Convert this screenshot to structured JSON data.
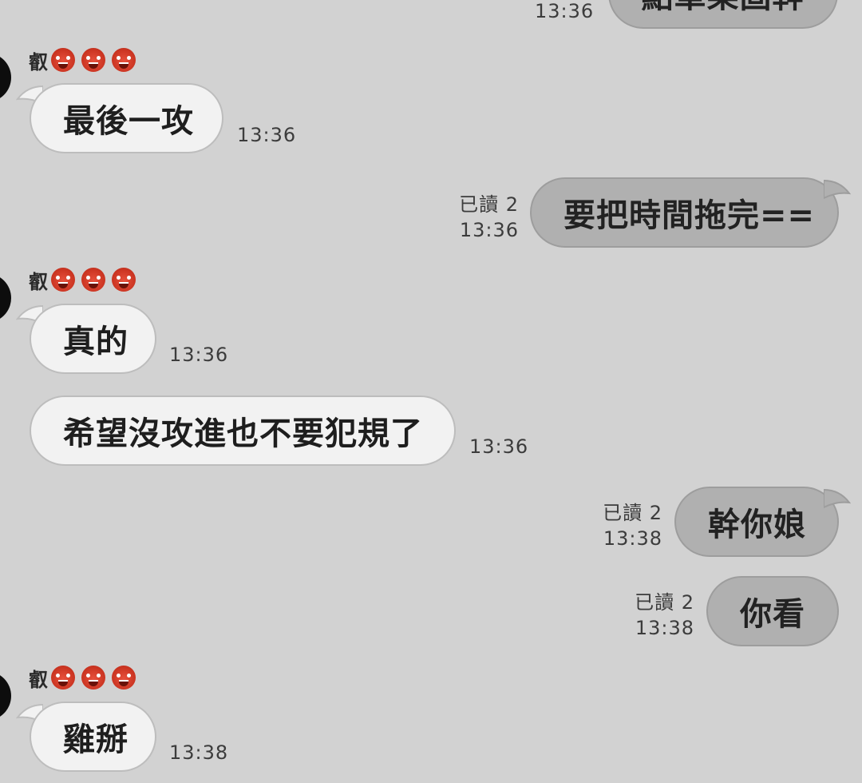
{
  "sender": {
    "name": "叡"
  },
  "messages": [
    {
      "dir": "out",
      "text": "點單桀固幹",
      "time": "13:36"
    },
    {
      "dir": "in",
      "text": "最後一攻",
      "time": "13:36"
    },
    {
      "dir": "out",
      "text": "要把時間拖完==",
      "read": "已讀 2",
      "time": "13:36"
    },
    {
      "dir": "in",
      "text": "真的",
      "time": "13:36"
    },
    {
      "dir": "in",
      "text": "希望沒攻進也不要犯規了",
      "time": "13:36"
    },
    {
      "dir": "out",
      "text": "幹你娘",
      "read": "已讀 2",
      "time": "13:38"
    },
    {
      "dir": "out",
      "text": "你看",
      "read": "已讀 2",
      "time": "13:38"
    },
    {
      "dir": "in",
      "text": "雞掰",
      "time": "13:38"
    }
  ],
  "colors": {
    "background": "#d2d2d2",
    "incoming_bubble": "#f2f2f2",
    "outgoing_bubble": "#b0b0b0"
  },
  "icons": {
    "sender_emoji": "japanese-ogre-emoji"
  }
}
